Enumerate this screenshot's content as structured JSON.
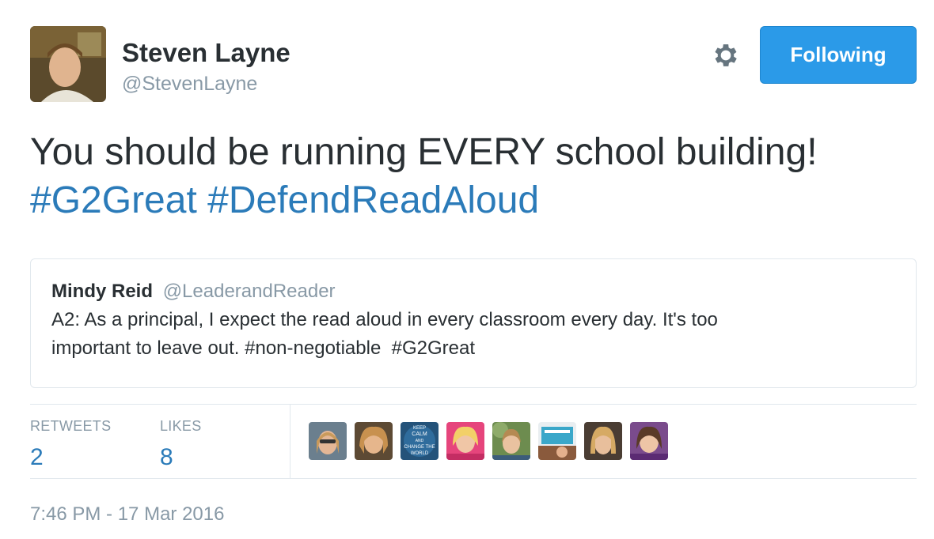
{
  "author": {
    "name": "Steven Layne",
    "handle": "@StevenLayne",
    "follow_button": "Following"
  },
  "tweet": {
    "text_line1": "You should be running EVERY school building!",
    "hashtags": [
      "#G2Great",
      "#DefendReadAloud"
    ]
  },
  "quoted_tweet": {
    "name": "Mindy Reid",
    "handle": "@LeaderandReader",
    "text_line1": "A2: As a principal, I expect the read aloud in every classroom every day. It's too",
    "text_line2_prefix": "important to leave out. #non-negotiable  ",
    "text_line2_hashtag": "#G2Great"
  },
  "stats": {
    "retweets_label": "RETWEETS",
    "retweets_count": "2",
    "likes_label": "LIKES",
    "likes_count": "8"
  },
  "liker_avatars": [
    {
      "icon": "liker-avatar"
    },
    {
      "icon": "liker-avatar"
    },
    {
      "icon": "liker-avatar",
      "text": [
        "KEEP",
        "CALM",
        "AND",
        "CHANGE THE",
        "WORLD"
      ]
    },
    {
      "icon": "liker-avatar"
    },
    {
      "icon": "liker-avatar"
    },
    {
      "icon": "liker-avatar"
    },
    {
      "icon": "liker-avatar"
    },
    {
      "icon": "liker-avatar"
    }
  ],
  "timestamp": "7:46 PM - 17 Mar 2016",
  "colors": {
    "link": "#2b7bb9",
    "button": "#2b9ae8",
    "muted": "#8899a6",
    "text": "#292f33",
    "border": "#e1e8ed"
  }
}
